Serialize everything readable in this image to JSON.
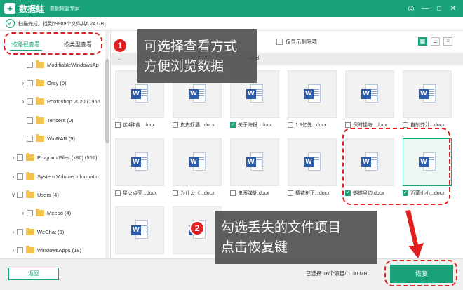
{
  "window": {
    "logo": "+",
    "title": "数据蛙",
    "subtitle": "数据恢复专家",
    "controls": [
      "◎",
      "—",
      "□",
      "✕"
    ]
  },
  "status": {
    "text": "扫描完成，找到59989个文件共6.24 GB。"
  },
  "sidebar": {
    "tabs": [
      "按路径查看",
      "按类型查看"
    ],
    "items": [
      {
        "label": "ModifiableWindowsAp",
        "arrow": "",
        "indent": 1
      },
      {
        "label": "Oray (0)",
        "arrow": "›",
        "indent": 1
      },
      {
        "label": "Photoshop 2020 (1955",
        "arrow": "›",
        "indent": 1
      },
      {
        "label": "Tencent (0)",
        "arrow": "",
        "indent": 1
      },
      {
        "label": "WinRAR (9)",
        "arrow": "",
        "indent": 1
      },
      {
        "label": "Program Files (x86) (561)",
        "arrow": "›",
        "indent": 0
      },
      {
        "label": "System Volume Informatio",
        "arrow": "›",
        "indent": 0
      },
      {
        "label": "Users (4)",
        "arrow": "∨",
        "indent": 0
      },
      {
        "label": "Meepo (4)",
        "arrow": "›",
        "indent": 1
      },
      {
        "label": "WeChat (9)",
        "arrow": "›",
        "indent": 0
      },
      {
        "label": "WindowsApps (18)",
        "arrow": "›",
        "indent": 0
      }
    ]
  },
  "toolbar": {
    "only_deleted": "仅显示删除项",
    "path_back": "←",
    "path_text": "word"
  },
  "files": [
    {
      "name": "这4种食...docx",
      "checked": false
    },
    {
      "name": "皮皮虾遇...docx",
      "checked": false
    },
    {
      "name": "关于海报...docx",
      "checked": true
    },
    {
      "name": "1.8亿先...docx",
      "checked": false
    },
    {
      "name": "保时捷与...docx",
      "checked": false
    },
    {
      "name": "自制芥汁...docx",
      "checked": false
    },
    {
      "name": "星火点亮...docx",
      "checked": false
    },
    {
      "name": "为什么《...docx",
      "checked": false
    },
    {
      "name": "鬼眼弹处.docx",
      "checked": false
    },
    {
      "name": "樱花树下...docx",
      "checked": false
    },
    {
      "name": "蝴蝶泉边.docx",
      "checked": true
    },
    {
      "name": "沂蒙山小...docx",
      "checked": true
    },
    {
      "name": "",
      "checked": false
    }
  ],
  "bottom": {
    "back": "返回",
    "selection_info": "已选择 16个项目/ 1.30 MB",
    "recover": "恢复"
  },
  "overlays": {
    "tip1_num": "1",
    "tip1_line1": "可选择查看方式",
    "tip1_line2": "方便浏览数据",
    "tip2_num": "2",
    "tip2_line1": "勾选丢失的文件项目",
    "tip2_line2": "点击恢复键"
  },
  "colors": {
    "brand": "#1aa37a",
    "annotation": "#e02020"
  }
}
